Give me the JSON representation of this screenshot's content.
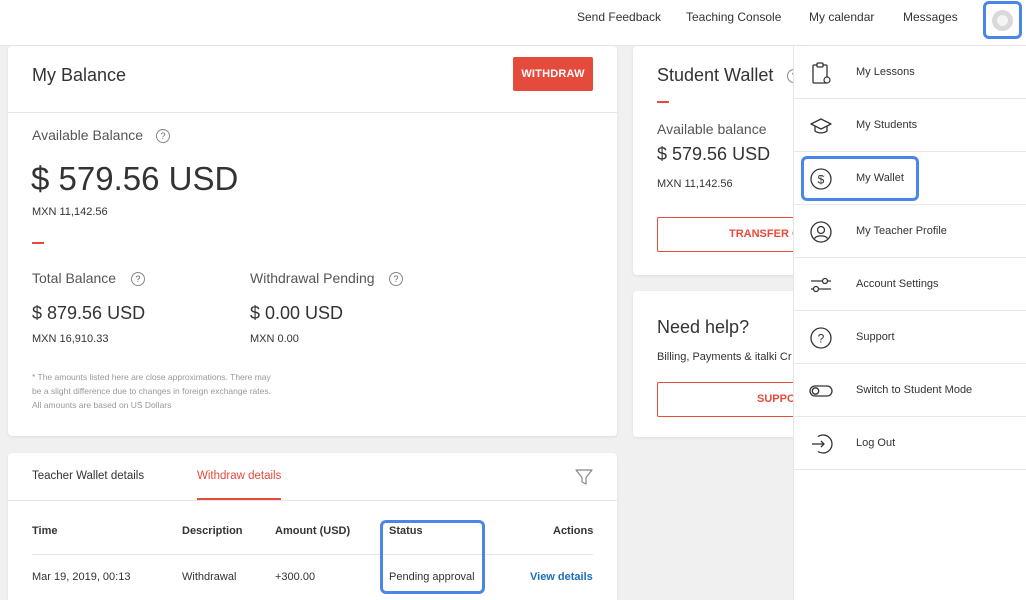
{
  "topnav": {
    "send_feedback": "Send Feedback",
    "teaching_console": "Teaching Console",
    "my_calendar": "My calendar",
    "messages": "Messages"
  },
  "balance": {
    "title": "My Balance",
    "withdraw_label": "WITHDRAW",
    "available_label": "Available Balance",
    "available_usd": "$ 579.56 USD",
    "available_mxn": "MXN 11,142.56",
    "total_label": "Total Balance",
    "total_usd": "$ 879.56 USD",
    "total_mxn": "MXN 16,910.33",
    "pending_label": "Withdrawal Pending",
    "pending_usd": "$ 0.00 USD",
    "pending_mxn": "MXN 0.00",
    "note_line1": "* The amounts listed here are close approximations. There may",
    "note_line2": "be a slight difference due to changes in foreign exchange rates.",
    "note_line3": "All amounts are based on US Dollars",
    "help_icon": "?"
  },
  "student_wallet": {
    "title": "Student Wallet",
    "available_label": "Available balance",
    "available_usd": "$ 579.56 USD",
    "available_mxn": "MXN 11,142.56",
    "transfer_label": "TRANSFER C"
  },
  "help": {
    "title": "Need help?",
    "text": "Billing, Payments & italki Cr",
    "support_label": "SUPPO"
  },
  "details": {
    "tabs": [
      "Teacher Wallet details",
      "Withdraw details"
    ],
    "columns": [
      "Time",
      "Description",
      "Amount (USD)",
      "Status",
      "Actions"
    ],
    "rows": [
      [
        "Mar 19, 2019, 00:13",
        "Withdrawal",
        "+300.00",
        "Pending approval",
        "View details"
      ]
    ]
  },
  "menu": {
    "items": [
      {
        "label": "My Lessons",
        "icon": "clipboard-icon"
      },
      {
        "label": "My Students",
        "icon": "graduation-cap-icon"
      },
      {
        "label": "My Wallet",
        "icon": "dollar-coin-icon"
      },
      {
        "label": "My Teacher Profile",
        "icon": "user-circle-icon"
      },
      {
        "label": "Account Settings",
        "icon": "sliders-icon"
      },
      {
        "label": "Support",
        "icon": "question-circle-icon"
      },
      {
        "label": "Switch to Student Mode",
        "icon": "toggle-icon"
      },
      {
        "label": "Log Out",
        "icon": "logout-icon"
      }
    ]
  },
  "colors": {
    "accent": "#e54b3c",
    "highlight": "#4a86e8",
    "link": "#1a6fb8"
  }
}
